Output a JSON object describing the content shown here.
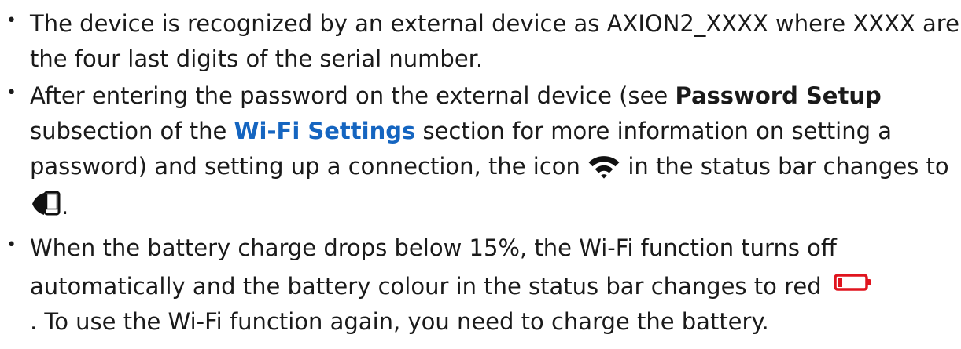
{
  "bullets": [
    {
      "text": "The device is recognized by an external device as AXION2_XXXX where XXXX are the four last digits of the serial number."
    },
    {
      "part1": "After entering the password on the external device (see ",
      "bold1": "Password Setup",
      "part2": " subsection of the ",
      "link": "Wi-Fi Settings",
      "part3": " section for more information on setting a password) and setting up a connection, the icon ",
      "part4": " in the status bar changes to ",
      "part5": "."
    },
    {
      "part1": "When the battery charge drops below 15%, the Wi-Fi function turns off automatically and the battery colour in the status bar changes to red ",
      "part2": ". To use the Wi-Fi function again, you need to charge the battery."
    }
  ],
  "icons": {
    "wifi": "wifi-icon",
    "connected": "phone-connected-icon",
    "battery": "low-battery-icon"
  },
  "colors": {
    "text": "#1a1a1a",
    "link": "#1565c0",
    "battery_low": "#e0141e"
  }
}
